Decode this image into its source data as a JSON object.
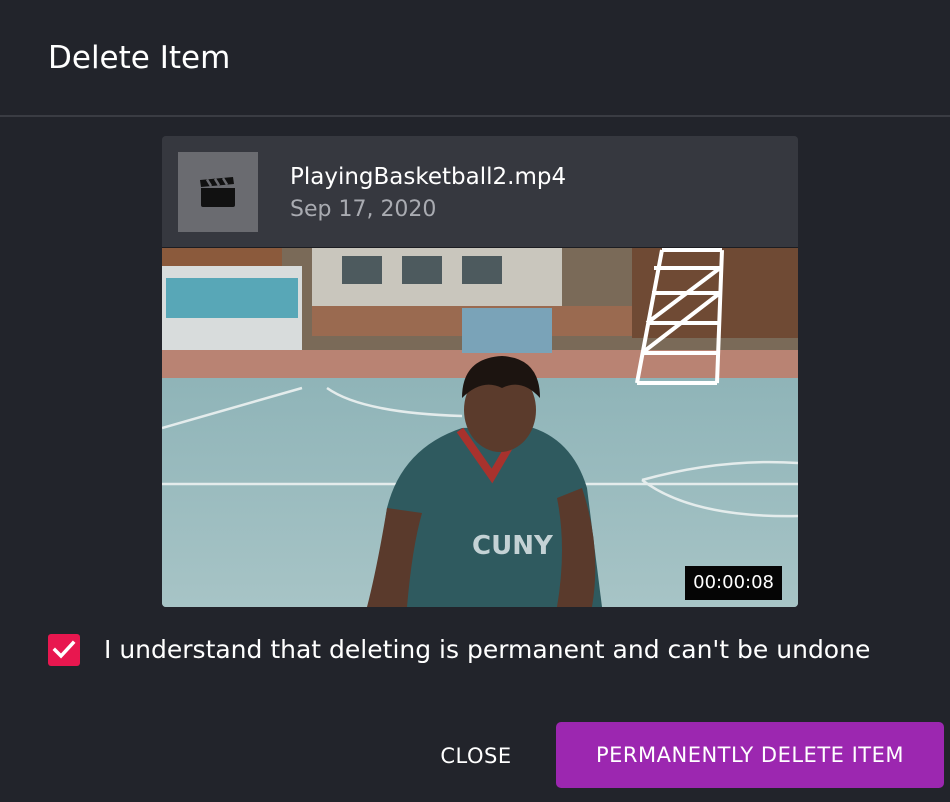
{
  "dialog": {
    "title": "Delete Item"
  },
  "item": {
    "file_name": "PlayingBasketball2.mp4",
    "date": "Sep 17, 2020",
    "thumbnail_icon": "clapperboard-icon",
    "duration": "00:00:08"
  },
  "confirm": {
    "checked": true,
    "label": "I understand that deleting is permanent and can't be undone"
  },
  "actions": {
    "close_label": "CLOSE",
    "delete_label": "PERMANENTLY DELETE ITEM"
  },
  "colors": {
    "background": "#22242b",
    "checkbox": "#e8174f",
    "delete_button": "#9c27b0"
  }
}
